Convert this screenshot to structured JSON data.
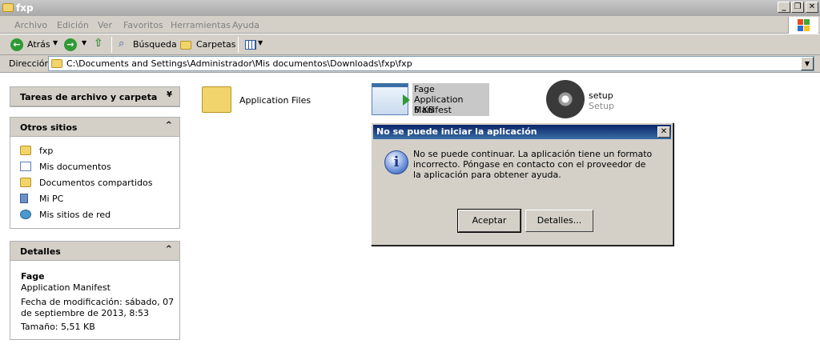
{
  "window": {
    "title": "fxp",
    "controls": {
      "minimize": "_",
      "restore": "❐",
      "close": "✕"
    }
  },
  "menu": [
    "Archivo",
    "Edición",
    "Ver",
    "Favoritos",
    "Herramientas",
    "Ayuda"
  ],
  "toolbar": {
    "back": "Atrás",
    "search": "Búsqueda",
    "folders": "Carpetas"
  },
  "address": {
    "label": "Dirección",
    "value": "C:\\Documents and Settings\\Administrador\\Mis documentos\\Downloads\\fxp\\fxp"
  },
  "sidebar": {
    "tasks": {
      "title": "Tareas de archivo y carpeta"
    },
    "other_places": {
      "title": "Otros sitios",
      "items": [
        {
          "label": "fxp",
          "icon": "folder-icon"
        },
        {
          "label": "Mis documentos",
          "icon": "documents-icon"
        },
        {
          "label": "Documentos compartidos",
          "icon": "folder-icon"
        },
        {
          "label": "Mi PC",
          "icon": "computer-icon"
        },
        {
          "label": "Mis sitios de red",
          "icon": "network-icon"
        }
      ]
    },
    "details": {
      "title": "Detalles",
      "name": "Fage",
      "type": "Application Manifest",
      "modified": "Fecha de modificación: sábado, 07 de septiembre de 2013, 8:53",
      "size": "Tamaño: 5,51 KB"
    }
  },
  "files": [
    {
      "name": "Application Files",
      "type": "",
      "size": ""
    },
    {
      "name": "Fage",
      "type": "Application Manifest",
      "size": "6 KB"
    },
    {
      "name": "setup",
      "type": "Setup",
      "size": ""
    }
  ],
  "dialog": {
    "title": "No se puede iniciar la aplicación",
    "message": "No se puede continuar. La aplicación tiene un formato incorrecto. Póngase en contacto con el proveedor de la aplicación para obtener ayuda.",
    "ok": "Aceptar",
    "details": "Detalles..."
  },
  "colors": {
    "dialog_title": "#0a246a",
    "panel_header": "#d4d0c8",
    "selection": "#c8c8c8"
  }
}
